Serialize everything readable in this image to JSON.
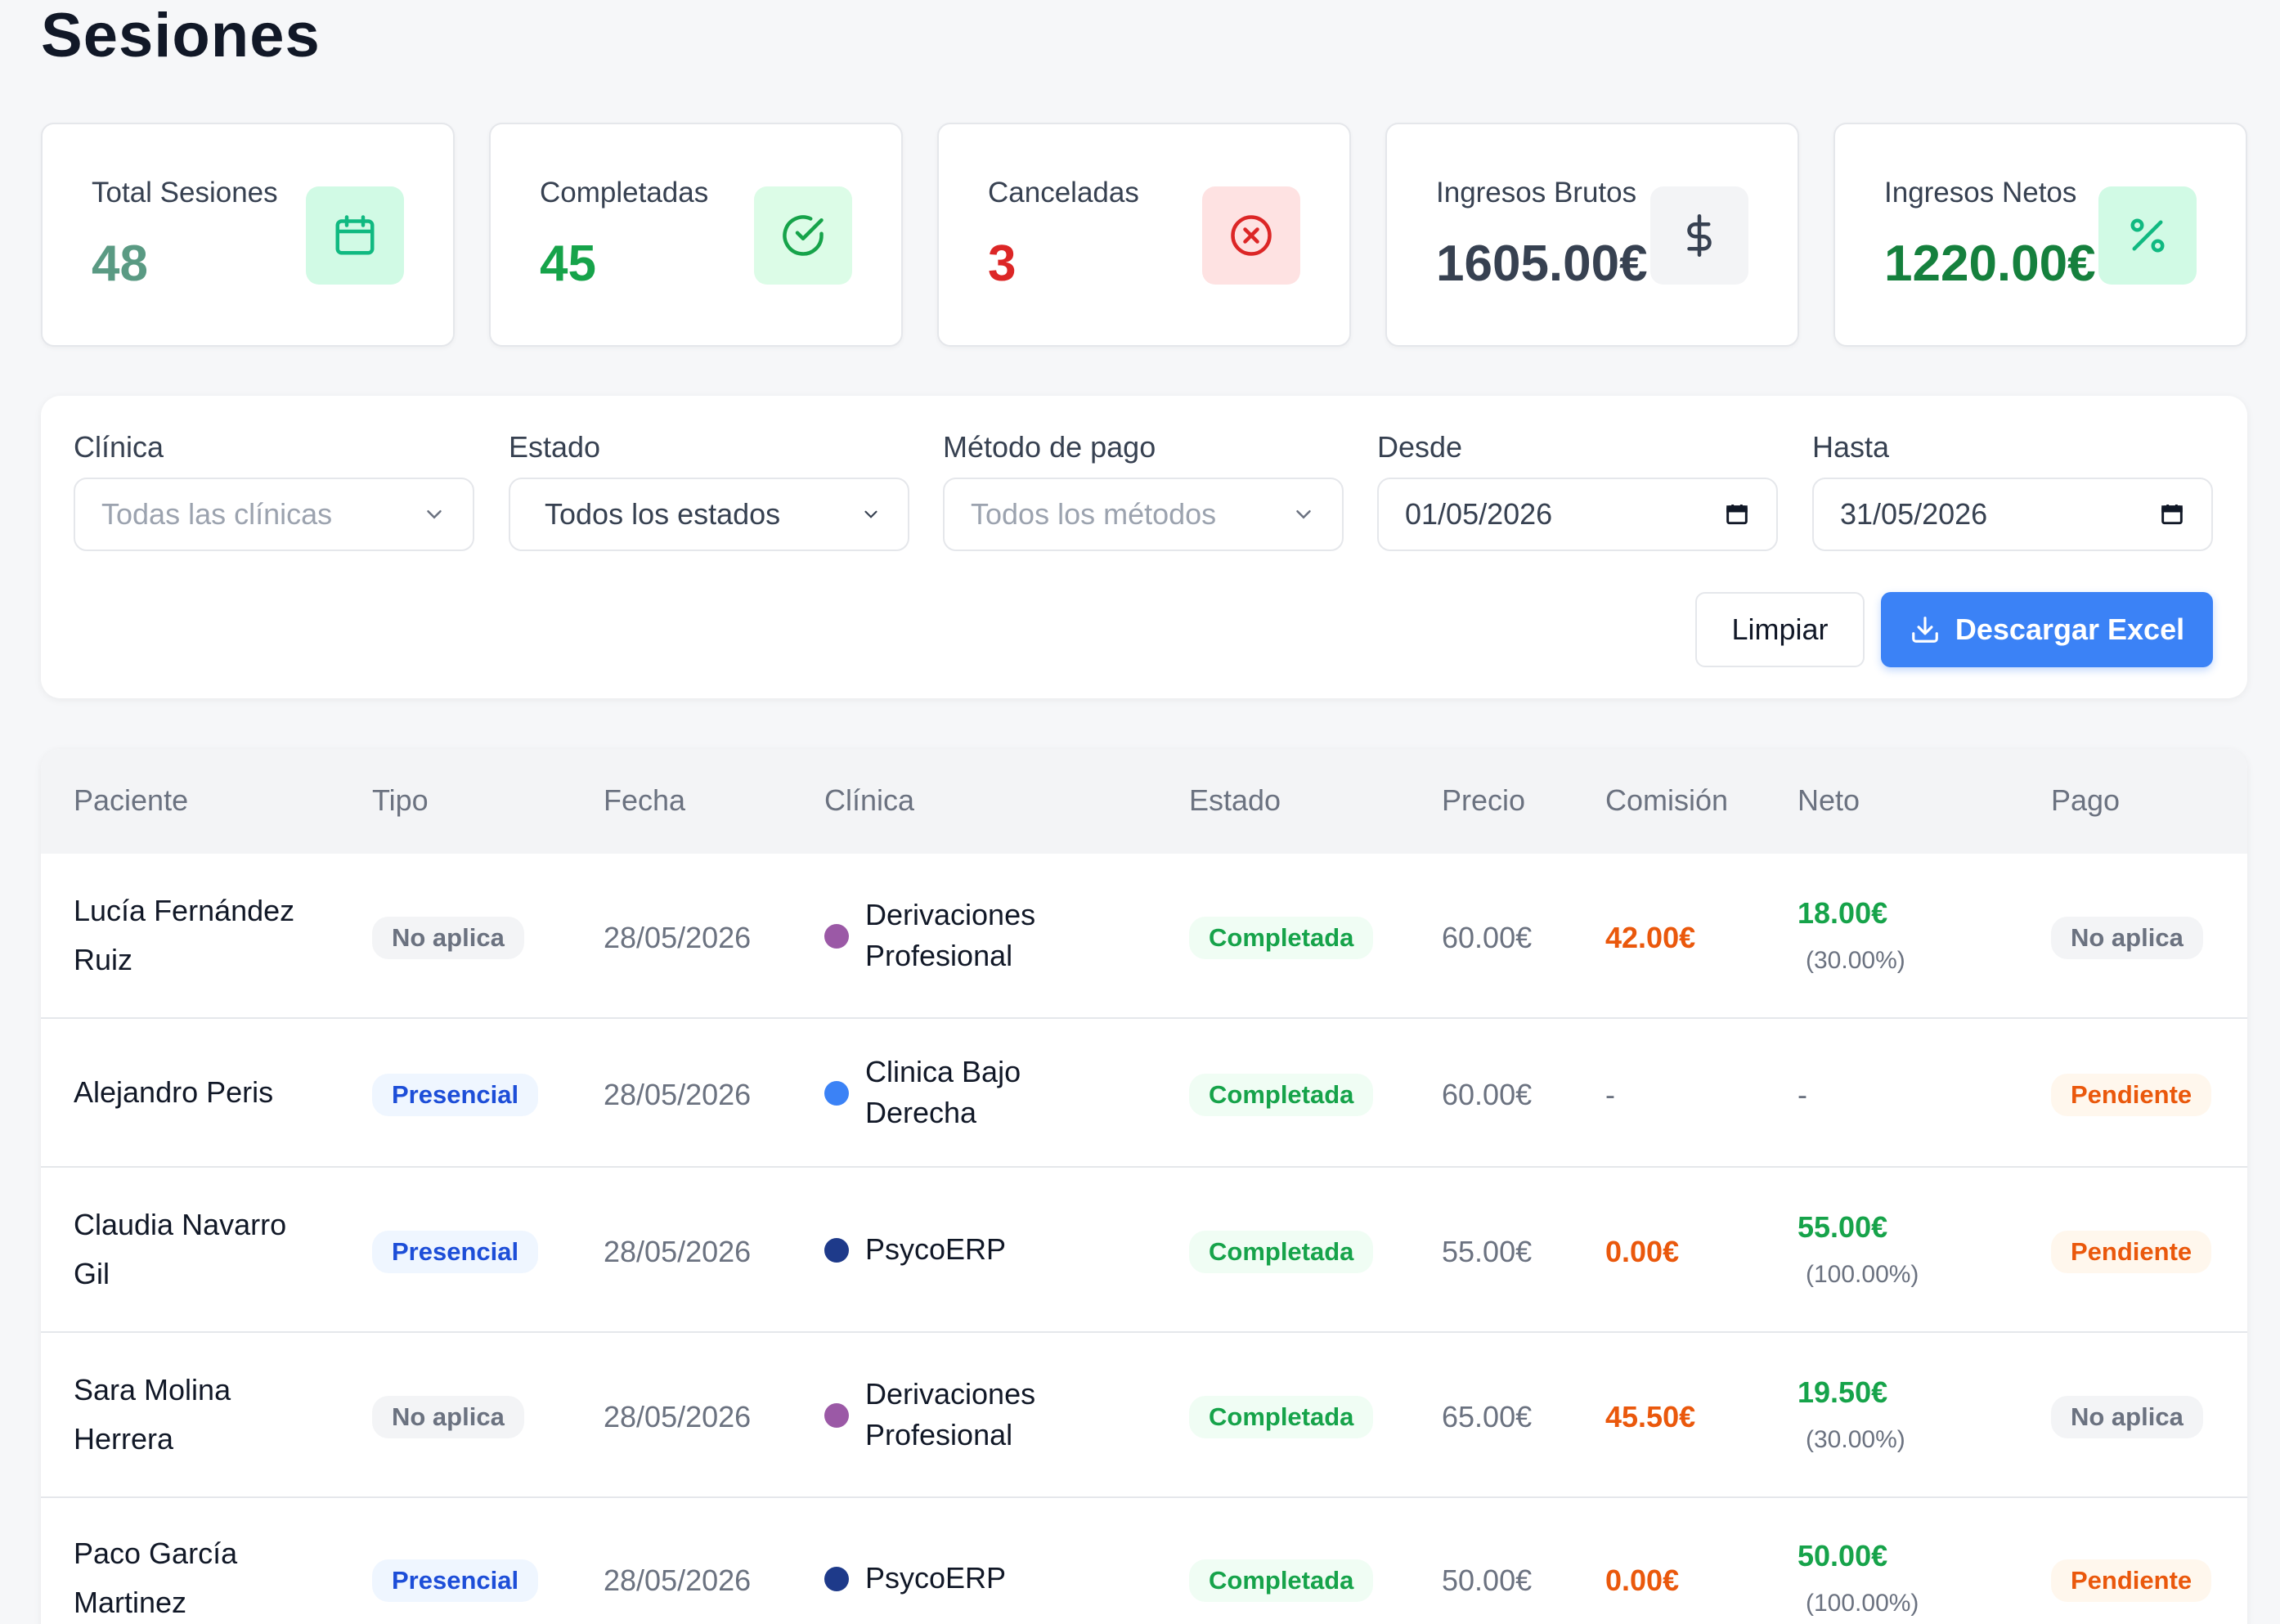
{
  "page": {
    "title": "Sesiones"
  },
  "stats": [
    {
      "label": "Total Sesiones",
      "value": "48",
      "icon": "calendar-icon",
      "value_color": "#5a9a83",
      "icon_bg": "#d1fae5",
      "icon_color": "#10b981"
    },
    {
      "label": "Completadas",
      "value": "45",
      "icon": "check-circle-icon",
      "value_color": "#16a34a",
      "icon_bg": "#dcfce7",
      "icon_color": "#16a34a"
    },
    {
      "label": "Canceladas",
      "value": "3",
      "icon": "x-circle-icon",
      "value_color": "#dc2626",
      "icon_bg": "#fee2e2",
      "icon_color": "#dc2626"
    },
    {
      "label": "Ingresos Brutos",
      "value": "1605.00€",
      "icon": "dollar-icon",
      "value_color": "#374151",
      "icon_bg": "#f3f4f6",
      "icon_color": "#374151"
    },
    {
      "label": "Ingresos Netos",
      "value": "1220.00€",
      "icon": "percent-icon",
      "value_color": "#15803d",
      "icon_bg": "#d1fae5",
      "icon_color": "#10b981"
    }
  ],
  "filters": {
    "clinica": {
      "label": "Clínica",
      "placeholder": "Todas las clínicas"
    },
    "estado": {
      "label": "Estado",
      "value": "Todos los estados"
    },
    "metodo": {
      "label": "Método de pago",
      "placeholder": "Todos los métodos"
    },
    "desde": {
      "label": "Desde",
      "value": "01/05/2026"
    },
    "hasta": {
      "label": "Hasta",
      "value": "31/05/2026"
    }
  },
  "actions": {
    "clear_label": "Limpiar",
    "download_label": "Descargar Excel"
  },
  "table": {
    "headers": [
      "Paciente",
      "Tipo",
      "Fecha",
      "Clínica",
      "Estado",
      "Precio",
      "Comisión",
      "Neto",
      "Pago"
    ],
    "rows": [
      {
        "patient_l1": "Lucía Fernández",
        "patient_l2": "Ruiz",
        "tipo": "No aplica",
        "tipo_kind": "na",
        "fecha": "28/05/2026",
        "clinic_l1": "Derivaciones",
        "clinic_l2": "Profesional",
        "clinic_color": "#9b59a6",
        "estado": "Completada",
        "precio": "60.00€",
        "comision": "42.00€",
        "neto": "18.00€",
        "neto_pct": "(30.00%)",
        "pago": "No aplica",
        "pago_kind": "na"
      },
      {
        "patient_l1": "Alejandro Peris",
        "patient_l2": "",
        "tipo": "Presencial",
        "tipo_kind": "pres",
        "fecha": "28/05/2026",
        "clinic_l1": "Clinica Bajo",
        "clinic_l2": "Derecha",
        "clinic_color": "#3b82f6",
        "estado": "Completada",
        "precio": "60.00€",
        "comision": "-",
        "neto": "-",
        "neto_pct": "",
        "pago": "Pendiente",
        "pago_kind": "pend"
      },
      {
        "patient_l1": "Claudia Navarro",
        "patient_l2": "Gil",
        "tipo": "Presencial",
        "tipo_kind": "pres",
        "fecha": "28/05/2026",
        "clinic_l1": "PsycoERP",
        "clinic_l2": "",
        "clinic_color": "#1e3a8a",
        "estado": "Completada",
        "precio": "55.00€",
        "comision": "0.00€",
        "neto": "55.00€",
        "neto_pct": "(100.00%)",
        "pago": "Pendiente",
        "pago_kind": "pend"
      },
      {
        "patient_l1": "Sara Molina",
        "patient_l2": "Herrera",
        "tipo": "No aplica",
        "tipo_kind": "na",
        "fecha": "28/05/2026",
        "clinic_l1": "Derivaciones",
        "clinic_l2": "Profesional",
        "clinic_color": "#9b59a6",
        "estado": "Completada",
        "precio": "65.00€",
        "comision": "45.50€",
        "neto": "19.50€",
        "neto_pct": "(30.00%)",
        "pago": "No aplica",
        "pago_kind": "na"
      },
      {
        "patient_l1": "Paco García",
        "patient_l2": "Martinez",
        "tipo": "Presencial",
        "tipo_kind": "pres",
        "fecha": "28/05/2026",
        "clinic_l1": "PsycoERP",
        "clinic_l2": "",
        "clinic_color": "#1e3a8a",
        "estado": "Completada",
        "precio": "50.00€",
        "comision": "0.00€",
        "neto": "50.00€",
        "neto_pct": "(100.00%)",
        "pago": "Pendiente",
        "pago_kind": "pend"
      }
    ]
  }
}
